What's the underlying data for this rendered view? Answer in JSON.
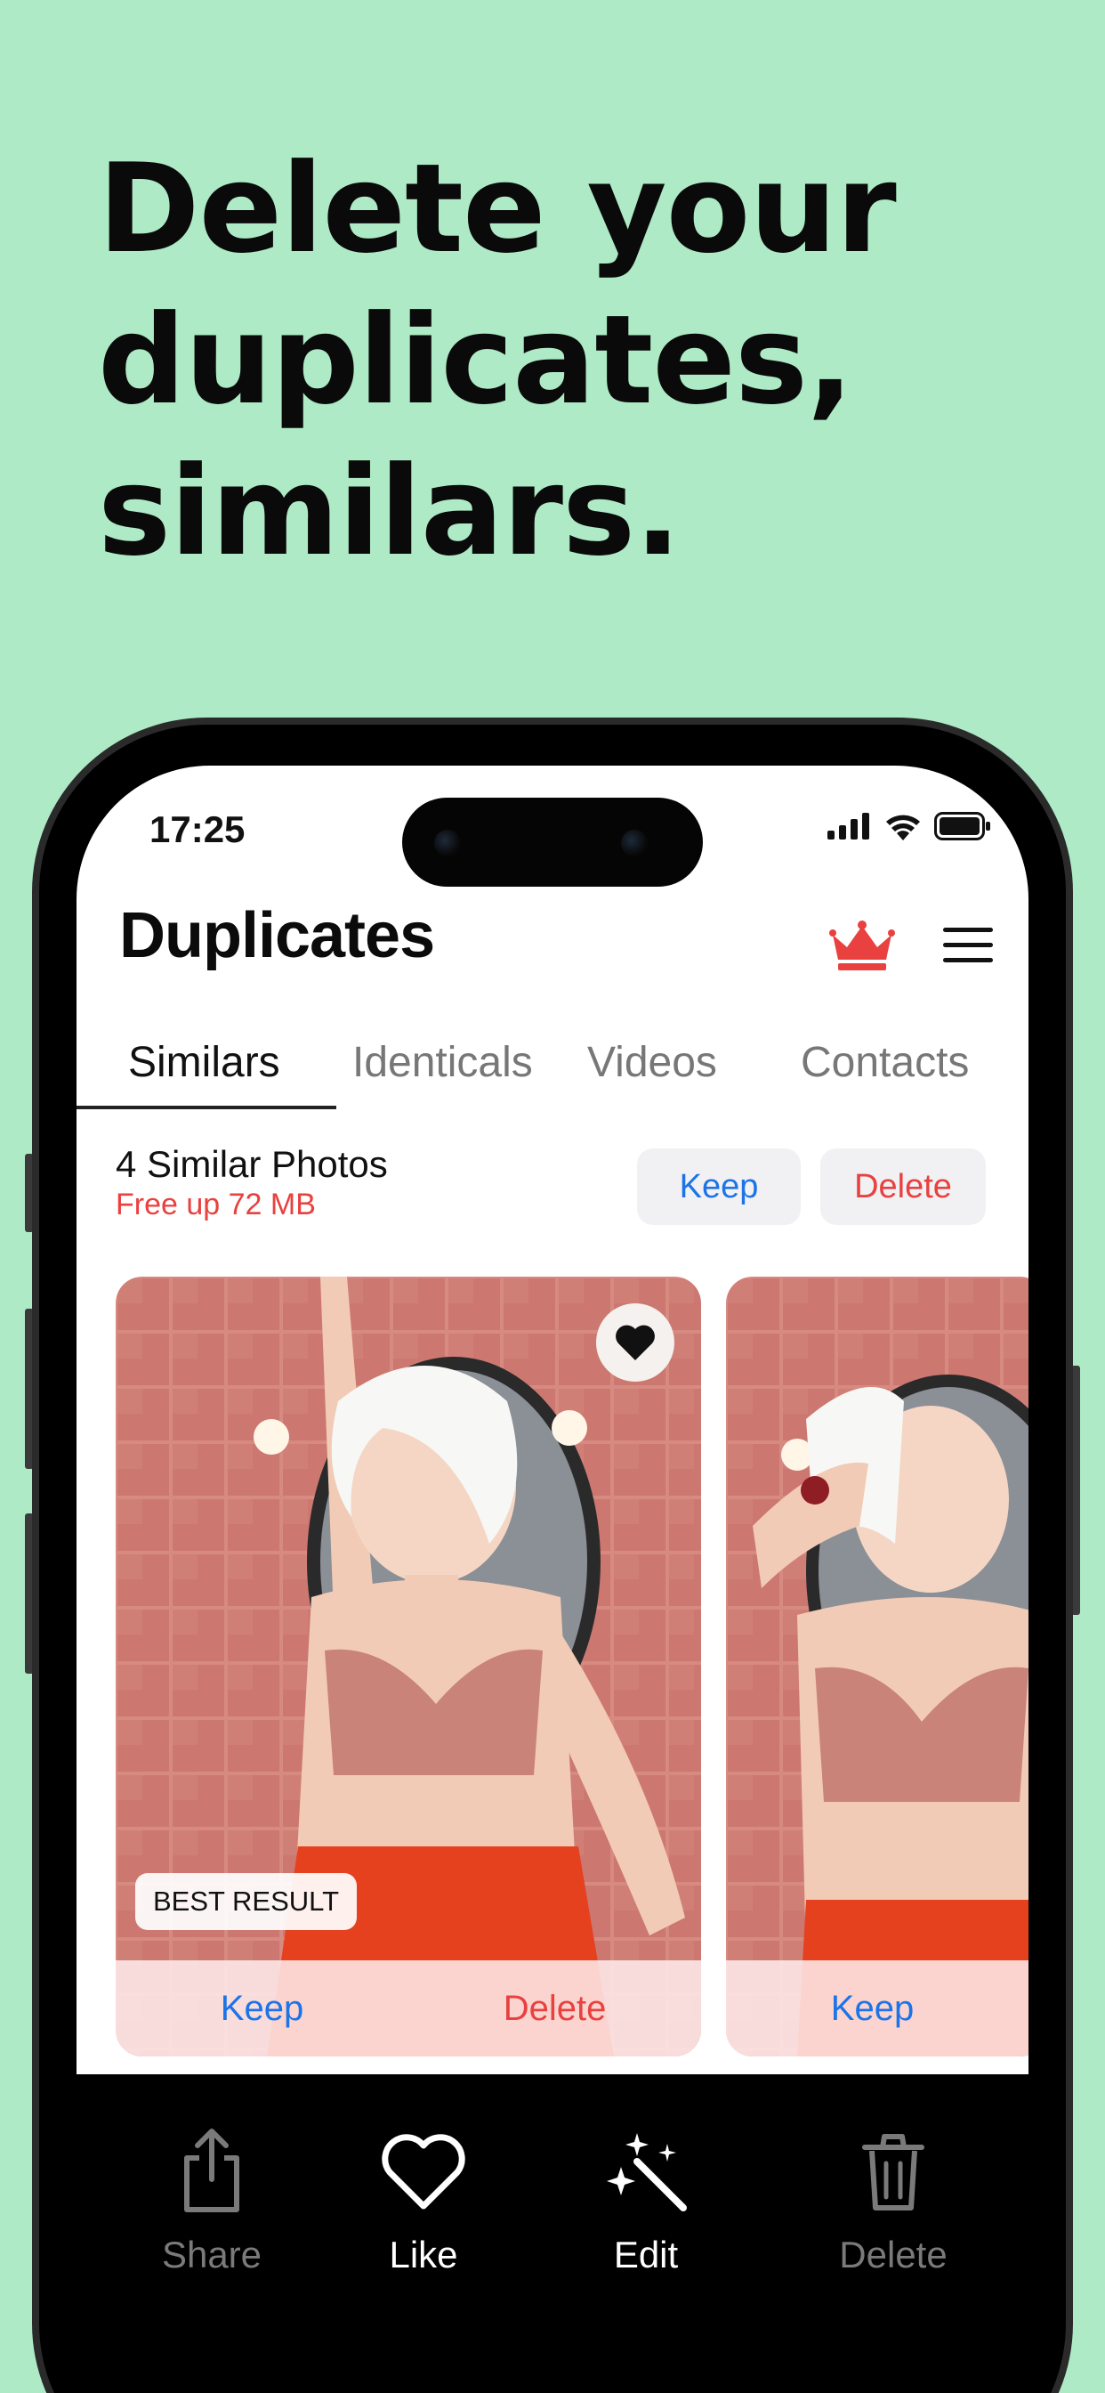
{
  "marketing": {
    "headline_lines": [
      "Delete your",
      "duplicates,",
      "similars."
    ],
    "background_color": "#aeeac5"
  },
  "status_bar": {
    "time": "17:25",
    "icons": [
      "cellular-signal-icon",
      "wifi-icon",
      "battery-icon"
    ]
  },
  "header": {
    "title": "Duplicates",
    "premium_icon": "crown-icon",
    "menu_icon": "hamburger-menu-icon"
  },
  "tabs": [
    {
      "label": "Similars",
      "active": true
    },
    {
      "label": "Identicals",
      "active": false
    },
    {
      "label": "Videos",
      "active": false
    },
    {
      "label": "Contacts",
      "active": false
    }
  ],
  "group": {
    "title": "4 Similar Photos",
    "subtitle": "Free up 72 MB",
    "keep_label": "Keep",
    "delete_label": "Delete"
  },
  "photos": [
    {
      "badge": "BEST RESULT",
      "favorite_icon": "heart-icon",
      "keep_label": "Keep",
      "delete_label": "Delete"
    },
    {
      "keep_label": "Keep"
    }
  ],
  "toolbar": {
    "items": [
      {
        "label": "Share",
        "icon": "share-icon",
        "enabled": false
      },
      {
        "label": "Like",
        "icon": "heart-outline-icon",
        "enabled": true
      },
      {
        "label": "Edit",
        "icon": "magic-wand-icon",
        "enabled": true
      },
      {
        "label": "Delete",
        "icon": "trash-icon",
        "enabled": false
      }
    ]
  },
  "colors": {
    "accent_blue": "#1c74e8",
    "accent_red": "#e8413f",
    "crown_red": "#e8413f"
  }
}
